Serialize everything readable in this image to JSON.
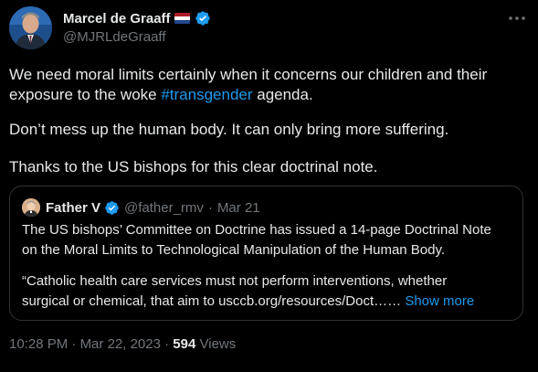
{
  "author": {
    "display_name": "Marcel de Graaff",
    "handle": "@MJRLdeGraaff",
    "flag": "netherlands-flag",
    "verified_color": "#1d9bf0"
  },
  "tweet": {
    "para1_before": "We need moral limits certainly when it concerns our children and their",
    "para1_line2_before": "exposure to the woke ",
    "hashtag": "#transgender",
    "para1_line2_after": " agenda.",
    "para2": "Don’t mess up the human body. It can only bring more suffering.",
    "para3": "Thanks to the US bishops for this clear doctrinal note."
  },
  "quote": {
    "display_name": "Father V",
    "handle": "@father_rmv",
    "separator": "·",
    "date": "Mar 21",
    "line1": "The US bishops’ Committee on Doctrine has issued a 14-page Doctrinal Note",
    "line2": "on the Moral Limits to Technological Manipulation of the Human Body.",
    "line3": "“Catholic health care services must not perform interventions, whether",
    "line4": "surgical or chemical, that aim to usccb.org/resources/Doct……",
    "show_more": "Show more"
  },
  "meta": {
    "time": "10:28 PM",
    "sep1": "·",
    "date": "Mar 22, 2023",
    "sep2": "·",
    "views_count": "594",
    "views_label": "Views"
  },
  "colors": {
    "background": "#000000",
    "text": "#e7e9ea",
    "muted": "#71767b",
    "link": "#1d9bf0",
    "border": "#2f3336"
  }
}
